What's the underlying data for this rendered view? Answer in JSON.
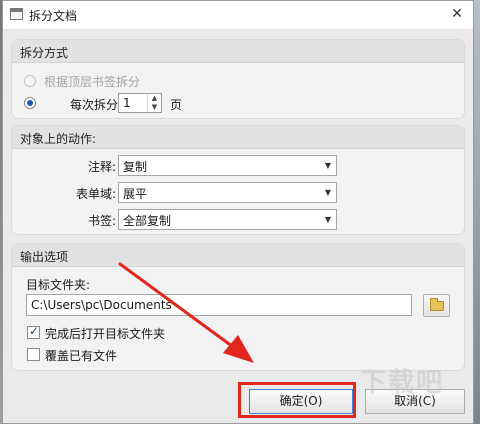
{
  "window": {
    "title": "拆分文档",
    "close_glyph": "✕"
  },
  "split_method": {
    "title": "拆分方式",
    "option_bookmark": "根据顶层书签拆分",
    "option_pages_prefix": "每次拆分",
    "pages_value": "1",
    "pages_suffix": "页",
    "selected": "每次拆分"
  },
  "actions": {
    "title": "对象上的动作:",
    "rows": [
      {
        "label": "注释:",
        "value": "复制"
      },
      {
        "label": "表单域:",
        "value": "展平"
      },
      {
        "label": "书签:",
        "value": "全部复制"
      }
    ]
  },
  "output": {
    "title": "输出选项",
    "folder_label": "目标文件夹:",
    "folder_value": "C:\\Users\\pc\\Documents",
    "open_after_label": "完成后打开目标文件夹",
    "open_after_checked": true,
    "overwrite_label": "覆盖已有文件",
    "overwrite_checked": false
  },
  "buttons": {
    "ok": "确定(O)",
    "cancel": "取消(C)"
  },
  "annotation": {
    "highlight_color": "#e0261d",
    "watermark": "下载吧"
  },
  "icons": {
    "app": "document-icon",
    "close": "close-icon",
    "folder": "folder-icon",
    "dropdown": "chevron-down-icon",
    "check": "checkmark-icon"
  }
}
